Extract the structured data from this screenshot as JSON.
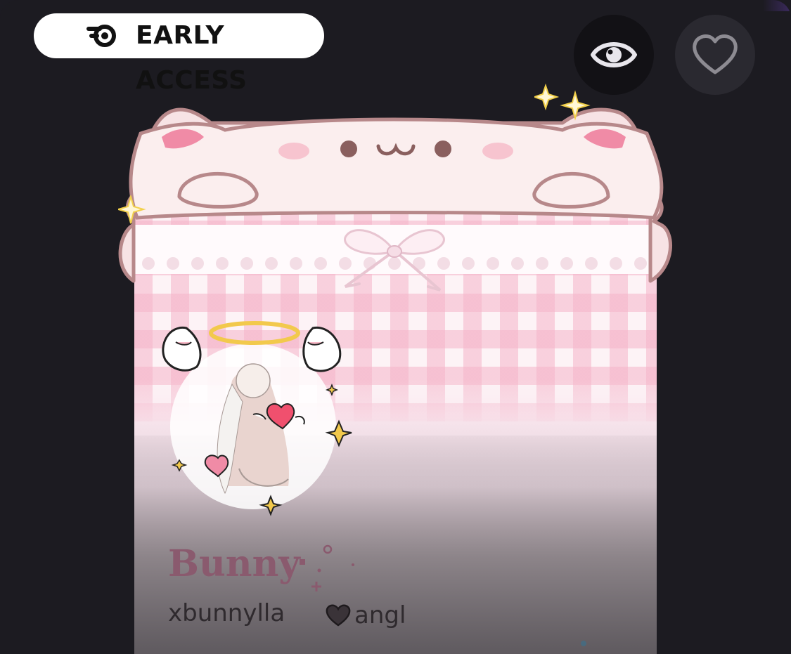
{
  "badge": {
    "label": "EARLY ACCESS",
    "icon": "early-access-logo-icon"
  },
  "actions": {
    "view": {
      "icon": "eye-icon"
    },
    "like": {
      "icon": "heart-outline-icon"
    }
  },
  "profile": {
    "display_name": "Bunny",
    "username": "xbunnylla",
    "pronoun_tag": "angl",
    "pronoun_icon": "heart-icon",
    "banner_decoration": "cat-frame-decoration",
    "avatar_decoration": "angel-wings-halo-decoration"
  },
  "colors": {
    "background": "#1c1b21",
    "badge_bg": "#ffffff",
    "display_name": "#8a5a6e",
    "card_pink": "#fbe6ee",
    "sparkle": "#f2d04a"
  }
}
